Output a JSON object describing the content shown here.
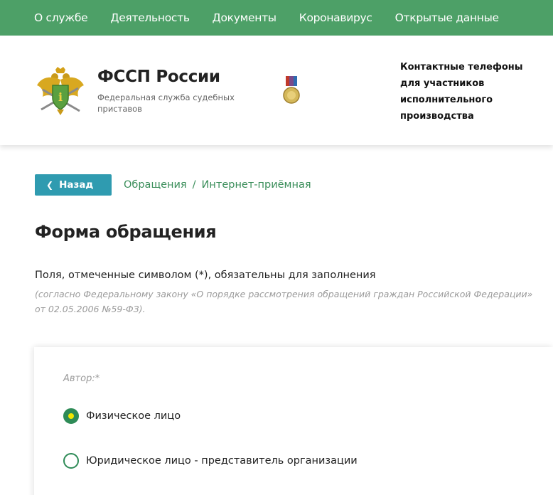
{
  "topnav": {
    "items": [
      "О службе",
      "Деятельность",
      "Документы",
      "Коронавирус",
      "Открытые данные"
    ]
  },
  "header": {
    "org_name": "ФССП России",
    "org_subtitle": "Федеральная служба судебных приставов",
    "contacts_link": "Контактные телефоны для участников исполнительного производства"
  },
  "breadcrumb": {
    "back_label": "Назад",
    "items": [
      "Обращения",
      "Интернет-приёмная"
    ],
    "separator": "/"
  },
  "page": {
    "title": "Форма обращения",
    "required_note": "Поля, отмеченные символом (*), обязательны для заполнения",
    "law_note": "(согласно Федеральному закону «О порядке рассмотрения обращений граждан Российской Федерации» от 02.05.2006 №59-ФЗ)."
  },
  "form": {
    "author_label": "Автор:*",
    "author_options": [
      {
        "label": "Физическое лицо",
        "checked": true
      },
      {
        "label": "Юридическое лицо - представитель организации",
        "checked": false
      }
    ]
  },
  "colors": {
    "nav_green": "#4da067",
    "accent_green": "#2e8b57",
    "back_button_blue": "#2f9bb0",
    "radio_dot_yellow": "#f2e600"
  },
  "icons": {
    "emblem": "fssp-emblem-icon",
    "medal": "medal-icon",
    "back": "chevron-left-icon"
  }
}
